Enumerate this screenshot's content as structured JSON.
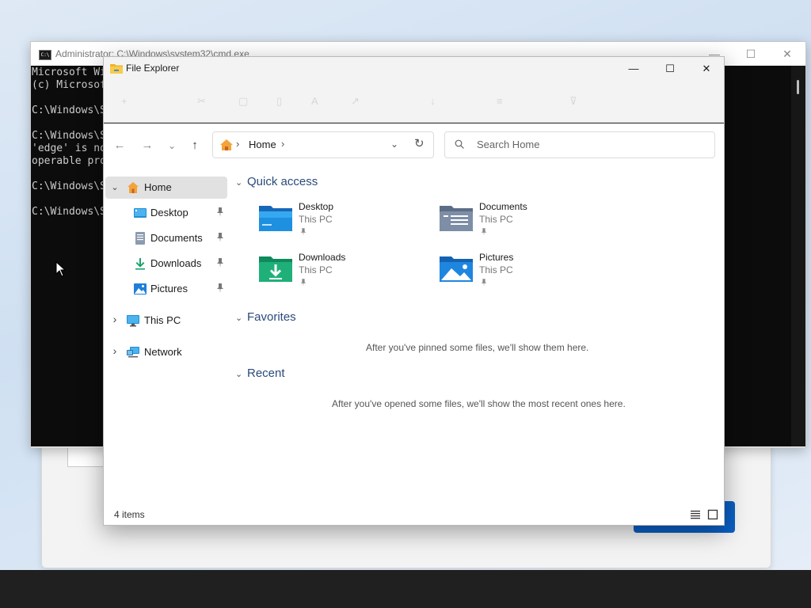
{
  "background": {
    "dialog_button_color": "#0a5fc4",
    "taskbar_color": "#202020"
  },
  "cmd": {
    "title": "Administrator: C:\\Windows\\system32\\cmd.exe",
    "icon_text": "C:\\",
    "lines": [
      "Microsoft Wi",
      "(c) Microsof",
      "",
      "C:\\Windows\\S",
      "",
      "C:\\Windows\\S",
      "'edge' is no",
      "operable pro",
      "",
      "C:\\Windows\\S",
      "",
      "C:\\Windows\\S"
    ],
    "controls": {
      "minimize": "—",
      "maximize": "☐",
      "close": "✕"
    }
  },
  "explorer": {
    "title": "File Explorer",
    "controls": {
      "minimize": "—",
      "maximize": "☐",
      "close": "✕"
    },
    "nav": {
      "back": "←",
      "forward": "→",
      "recent": "⌄",
      "up": "↑"
    },
    "address": {
      "separator": "›",
      "location": "Home",
      "dropdown": "⌄",
      "refresh": "↻"
    },
    "search": {
      "placeholder": "Search Home"
    },
    "sidebar": {
      "items": [
        {
          "label": "Home",
          "expanded_chevron": "⌄",
          "icon": "home-icon"
        },
        {
          "label": "Desktop",
          "icon": "desktop-icon",
          "pinned": true
        },
        {
          "label": "Documents",
          "icon": "documents-icon",
          "pinned": true
        },
        {
          "label": "Downloads",
          "icon": "downloads-icon",
          "pinned": true
        },
        {
          "label": "Pictures",
          "icon": "pictures-icon",
          "pinned": true
        },
        {
          "label": "This PC",
          "collapsed_chevron": "›",
          "icon": "this-pc-icon"
        },
        {
          "label": "Network",
          "collapsed_chevron": "›",
          "icon": "network-icon"
        }
      ]
    },
    "sections": {
      "quick_access": "Quick access",
      "favorites": "Favorites",
      "recent": "Recent",
      "chevron": "⌄"
    },
    "quick_access": [
      {
        "name": "Desktop",
        "location": "This PC",
        "icon": "desktop-folder-icon"
      },
      {
        "name": "Documents",
        "location": "This PC",
        "icon": "documents-folder-icon"
      },
      {
        "name": "Downloads",
        "location": "This PC",
        "icon": "downloads-folder-icon"
      },
      {
        "name": "Pictures",
        "location": "This PC",
        "icon": "pictures-folder-icon"
      }
    ],
    "favorites_empty": "After you've pinned some files, we'll show them here.",
    "recent_empty": "After you've opened some files, we'll show the most recent ones here.",
    "status": {
      "item_count": "4 items"
    },
    "accent": "#0067c0"
  }
}
